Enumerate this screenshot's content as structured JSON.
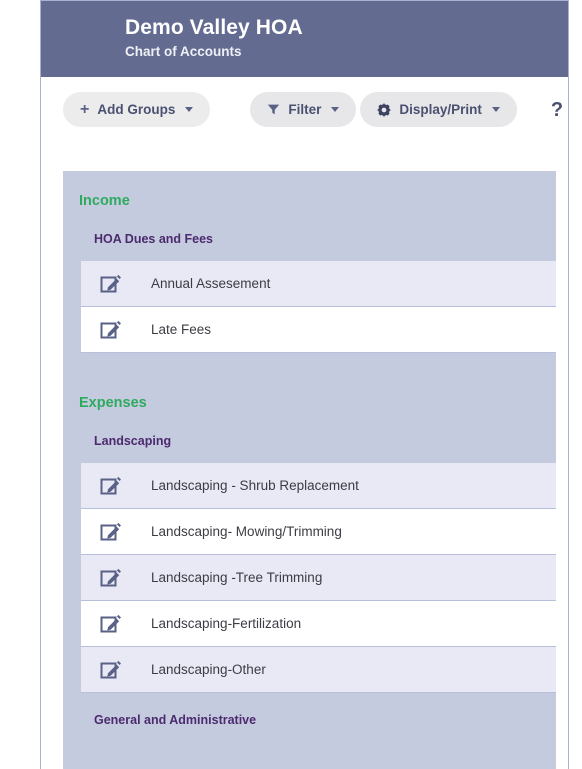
{
  "header": {
    "title": "Demo Valley HOA",
    "subtitle": "Chart of Accounts",
    "bg_color": "#646b90"
  },
  "toolbar": {
    "add_groups_label": "Add Groups",
    "add_groups_icon": "plus-icon",
    "filter_label": "Filter",
    "filter_icon": "funnel-icon",
    "display_print_label": "Display/Print",
    "display_print_icon": "gear-icon",
    "help_label": "?",
    "caret_icon": "chevron-down-icon"
  },
  "accent_colors": {
    "group_green": "#2eaa5f",
    "subgroup_purple": "#4b2a6e",
    "card_bg": "#c5cbdf",
    "row_alt": "#e8e9f4",
    "header": "#646b90"
  },
  "row_icon": "edit-pencil-icon",
  "groups": [
    {
      "name": "Income",
      "subgroups": [
        {
          "name": "HOA Dues and Fees",
          "accounts": [
            {
              "name": "Annual Assesement"
            },
            {
              "name": "Late Fees"
            }
          ]
        }
      ]
    },
    {
      "name": "Expenses",
      "subgroups": [
        {
          "name": "Landscaping",
          "accounts": [
            {
              "name": "Landscaping - Shrub Replacement"
            },
            {
              "name": "Landscaping- Mowing/Trimming"
            },
            {
              "name": "Landscaping -Tree Trimming"
            },
            {
              "name": "Landscaping-Fertilization"
            },
            {
              "name": "Landscaping-Other"
            }
          ]
        },
        {
          "name": "General and Administrative",
          "accounts": []
        }
      ]
    }
  ]
}
